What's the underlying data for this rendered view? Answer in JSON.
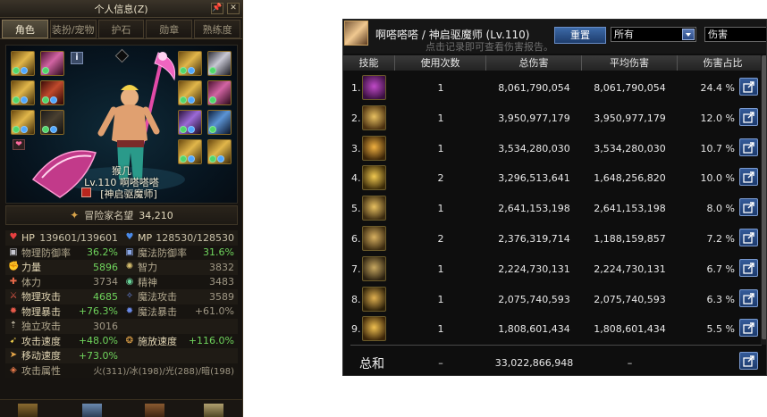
{
  "left_panel": {
    "title": "个人信息(Z)",
    "title_buttons": [
      "pin-icon",
      "close-icon"
    ],
    "tabs": [
      "角色",
      "装扮/宠物",
      "护石",
      "勋章",
      "熟练度"
    ],
    "active_tab": "角色",
    "character": {
      "guild": "猴几",
      "level_name": "Lv.110 啊嗒嗒嗒",
      "job": "[神启驱魔师]"
    },
    "fame": {
      "label": "冒险家名望",
      "value": "34,210"
    },
    "stats": {
      "hp_label": "HP",
      "hp_value": "139601/139601",
      "mp_label": "MP",
      "mp_value": "128530/128530",
      "pdef_label": "物理防御率",
      "pdef_value": "36.2%",
      "mdef_label": "魔法防御率",
      "mdef_value": "31.6%",
      "str_label": "力量",
      "str_value": "5896",
      "int_label": "智力",
      "int_value": "3832",
      "vit_label": "体力",
      "vit_value": "3734",
      "spr_label": "精神",
      "spr_value": "3483",
      "patk_label": "物理攻击",
      "patk_value": "4685",
      "matk_label": "魔法攻击",
      "matk_value": "3589",
      "pcrit_label": "物理暴击",
      "pcrit_value": "+76.3%",
      "mcrit_label": "魔法暴击",
      "mcrit_value": "+61.0%",
      "indep_label": "独立攻击",
      "indep_value": "3016",
      "aspd_label": "攻击速度",
      "aspd_value": "+48.0%",
      "cspd_label": "施放速度",
      "cspd_value": "+116.0%",
      "mspd_label": "移动速度",
      "mspd_value": "+73.0%",
      "elem_label": "攻击属性",
      "elem_value": "火(311)/冰(198)/光(288)/暗(198)"
    }
  },
  "right_panel": {
    "player_name": "啊嗒嗒嗒",
    "class_info": "/ 神启驱魔师 (Lv.110)",
    "hint": "点击记录即可查看伤害报告。",
    "reset_label": "重置",
    "filter_all": "所有",
    "filter_damage": "伤害",
    "headers": [
      "技能",
      "使用次数",
      "总伤害",
      "平均伤害",
      "伤害占比"
    ],
    "rows": [
      {
        "idx": "1.",
        "count": "1",
        "total": "8,061,790,054",
        "avg": "8,061,790,054",
        "pct": "24.4 %"
      },
      {
        "idx": "2.",
        "count": "1",
        "total": "3,950,977,179",
        "avg": "3,950,977,179",
        "pct": "12.0 %"
      },
      {
        "idx": "3.",
        "count": "1",
        "total": "3,534,280,030",
        "avg": "3,534,280,030",
        "pct": "10.7 %"
      },
      {
        "idx": "4.",
        "count": "2",
        "total": "3,296,513,641",
        "avg": "1,648,256,820",
        "pct": "10.0 %"
      },
      {
        "idx": "5.",
        "count": "1",
        "total": "2,641,153,198",
        "avg": "2,641,153,198",
        "pct": "8.0 %"
      },
      {
        "idx": "6.",
        "count": "2",
        "total": "2,376,319,714",
        "avg": "1,188,159,857",
        "pct": "7.2 %"
      },
      {
        "idx": "7.",
        "count": "1",
        "total": "2,224,730,131",
        "avg": "2,224,730,131",
        "pct": "6.7 %"
      },
      {
        "idx": "8.",
        "count": "1",
        "total": "2,075,740,593",
        "avg": "2,075,740,593",
        "pct": "6.3 %"
      },
      {
        "idx": "9.",
        "count": "1",
        "total": "1,808,601,434",
        "avg": "1,808,601,434",
        "pct": "5.5 %"
      }
    ],
    "total": {
      "label": "总和",
      "count": "–",
      "total": "33,022,866,948",
      "avg": "–"
    }
  }
}
